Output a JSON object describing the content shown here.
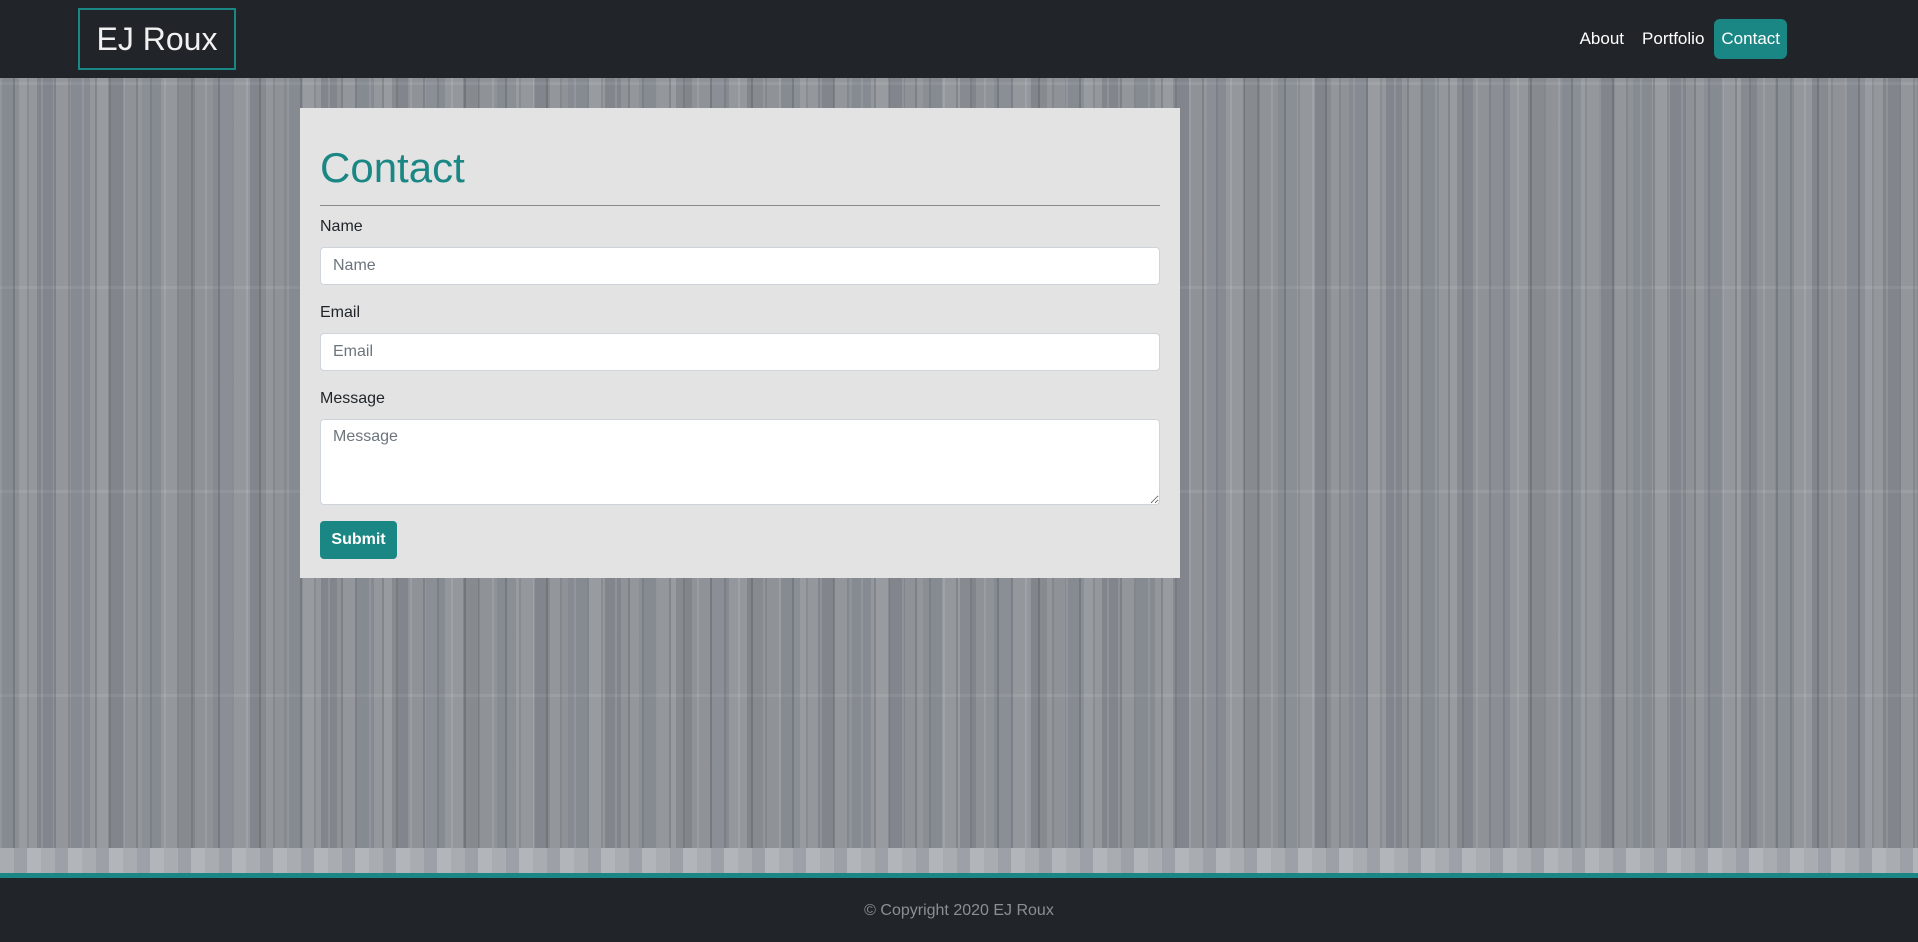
{
  "header": {
    "brand": "EJ Roux",
    "nav": [
      {
        "label": "About"
      },
      {
        "label": "Portfolio"
      },
      {
        "label": "Contact",
        "active": true
      }
    ]
  },
  "contact_form": {
    "title": "Contact",
    "name_label": "Name",
    "name_placeholder": "Name",
    "email_label": "Email",
    "email_placeholder": "Email",
    "message_label": "Message",
    "message_placeholder": "Message",
    "submit_label": "Submit"
  },
  "footer": {
    "copyright": "© Copyright 2020 EJ Roux"
  },
  "colors": {
    "accent": "#1b8785",
    "navbar": "#212529",
    "card": "#e3e3e3"
  }
}
